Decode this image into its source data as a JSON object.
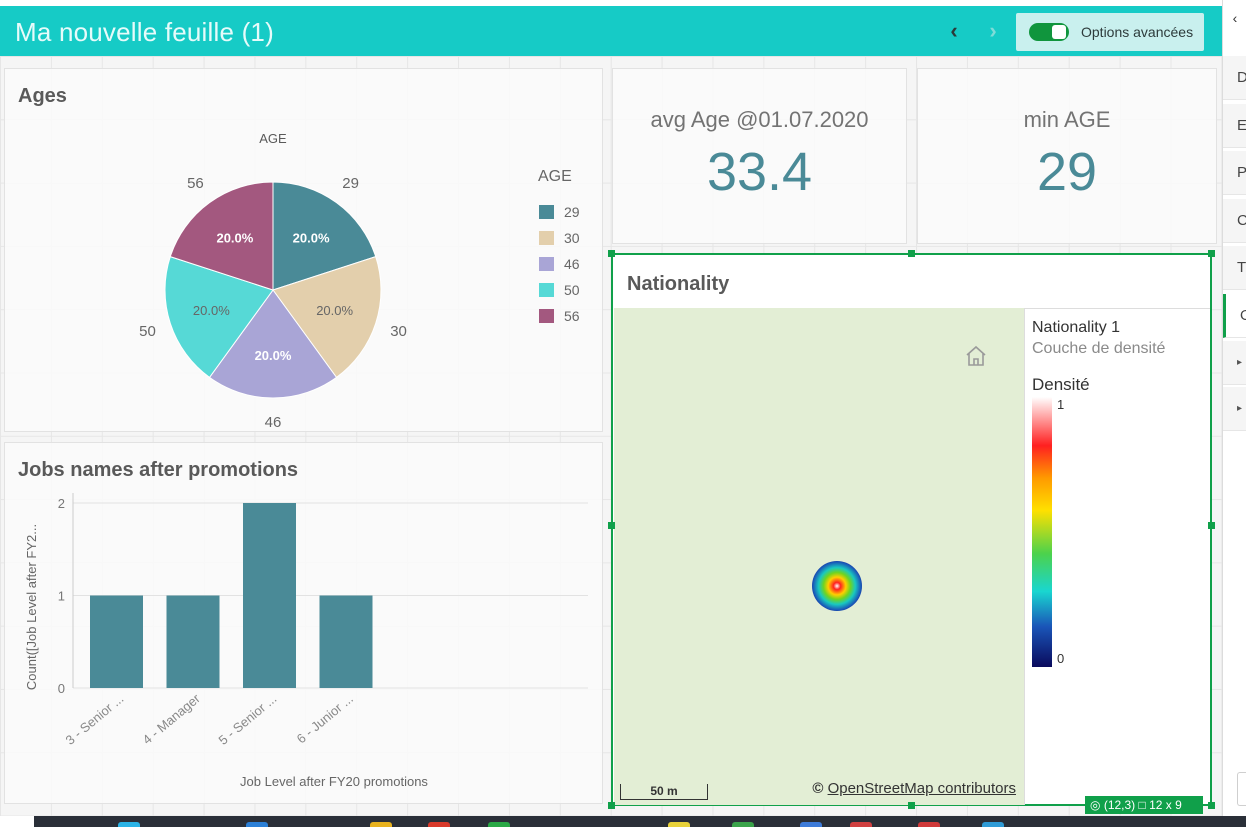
{
  "sheet": {
    "title": "Ma nouvelle feuille (1)"
  },
  "toolbar": {
    "prev_icon": "chevron-left-icon",
    "next_icon": "chevron-right-icon",
    "advanced_label": "Options avancées",
    "advanced_on": true
  },
  "panels": {
    "ages": {
      "title": "Ages"
    },
    "jobs": {
      "title": "Jobs names after promotions"
    },
    "kpi_avg": {
      "label": "avg Age @01.07.2020",
      "value": "33.4"
    },
    "kpi_min": {
      "label": "min AGE",
      "value": "29"
    },
    "nationality": {
      "title": "Nationality",
      "layer_name": "Nationality 1",
      "layer_type": "Couche de densité",
      "density_label": "Densité",
      "density_max": "1",
      "density_min": "0",
      "scale_label": "50 m",
      "attribution_prefix": "©",
      "attribution_link": "OpenStreetMap contributors",
      "home_icon": "home-icon"
    }
  },
  "selection_status": {
    "position": "(12,3)",
    "size": "12 x 9"
  },
  "right_pane": {
    "items": [
      "D",
      "E",
      "P",
      "C",
      "T",
      "O"
    ],
    "selected_index": 5,
    "expanders": 2
  },
  "colors": {
    "accent": "#16cbc6",
    "selection": "#10a04a",
    "series": [
      "#4a8a97",
      "#e3cfac",
      "#a9a5d6",
      "#56d9d6",
      "#a3587f"
    ]
  },
  "chart_data": [
    {
      "type": "pie",
      "title": "AGE",
      "legend_title": "AGE",
      "legend_position": "right",
      "categories": [
        "29",
        "30",
        "46",
        "50",
        "56"
      ],
      "values": [
        20.0,
        20.0,
        20.0,
        20.0,
        20.0
      ],
      "labels": [
        "20.0%",
        "20.0%",
        "20.0%",
        "20.0%",
        "20.0%"
      ]
    },
    {
      "type": "bar",
      "categories": [
        "3 - Senior ...",
        "4 - Manager",
        "5 - Senior ...",
        "6 - Junior ..."
      ],
      "values": [
        1,
        1,
        2,
        1
      ],
      "xlabel": "Job Level after FY20 promotions",
      "ylabel": "Count([Job Level after FY2...",
      "ylim": [
        0,
        2
      ],
      "yticks": [
        0,
        1,
        2
      ],
      "grid": true
    }
  ]
}
